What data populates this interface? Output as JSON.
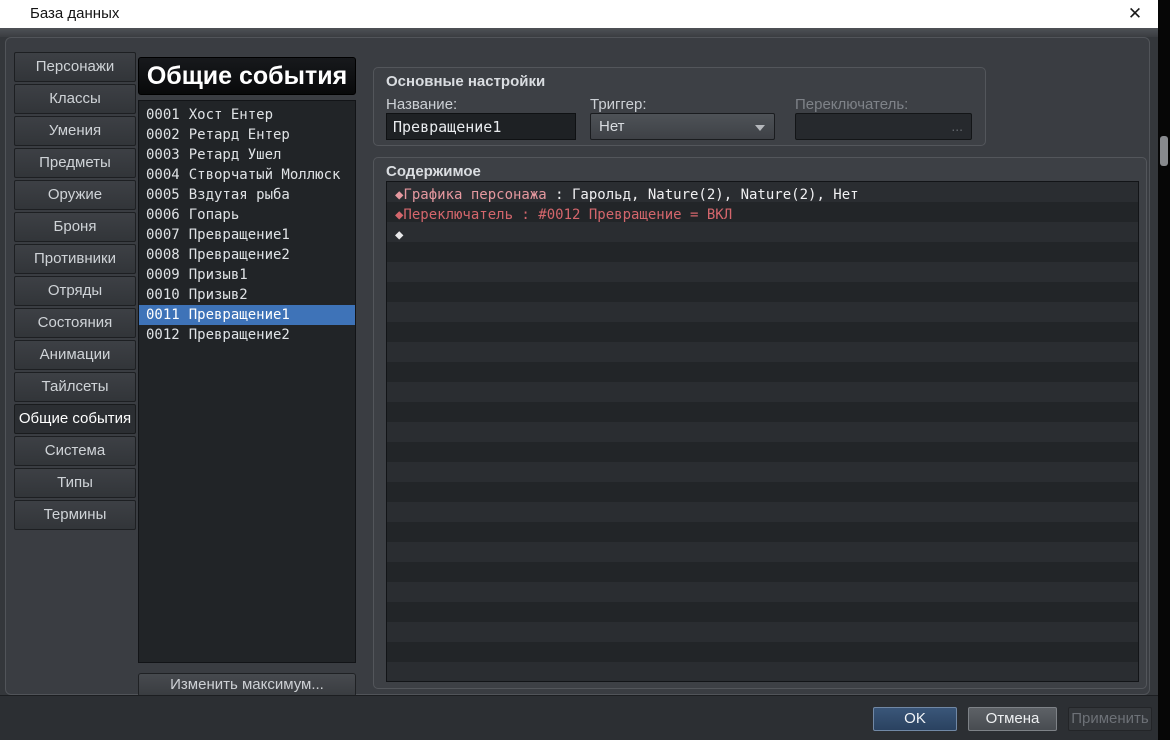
{
  "window": {
    "title": "База данных",
    "close_glyph": "✕"
  },
  "sidebar": {
    "tabs": [
      {
        "label": "Персонажи",
        "active": false
      },
      {
        "label": "Классы",
        "active": false
      },
      {
        "label": "Умения",
        "active": false
      },
      {
        "label": "Предметы",
        "active": false
      },
      {
        "label": "Оружие",
        "active": false
      },
      {
        "label": "Броня",
        "active": false
      },
      {
        "label": "Противники",
        "active": false
      },
      {
        "label": "Отряды",
        "active": false
      },
      {
        "label": "Состояния",
        "active": false
      },
      {
        "label": "Анимации",
        "active": false
      },
      {
        "label": "Тайлсеты",
        "active": false
      },
      {
        "label": "Общие события",
        "active": true
      },
      {
        "label": "Система",
        "active": false
      },
      {
        "label": "Типы",
        "active": false
      },
      {
        "label": "Термины",
        "active": false
      }
    ]
  },
  "list_panel": {
    "header": "Общие события",
    "selected_index": 10,
    "items": [
      {
        "id": "0001",
        "name": "Хост Ентер"
      },
      {
        "id": "0002",
        "name": "Ретард Ентер"
      },
      {
        "id": "0003",
        "name": "Ретард Ушел"
      },
      {
        "id": "0004",
        "name": "Створчатый Моллюск"
      },
      {
        "id": "0005",
        "name": "Вздутая рыба"
      },
      {
        "id": "0006",
        "name": "Гопарь"
      },
      {
        "id": "0007",
        "name": "Превращение1"
      },
      {
        "id": "0008",
        "name": "Превращение2"
      },
      {
        "id": "0009",
        "name": "Призыв1"
      },
      {
        "id": "0010",
        "name": "Призыв2"
      },
      {
        "id": "0011",
        "name": "Превращение1"
      },
      {
        "id": "0012",
        "name": "Превращение2"
      }
    ],
    "change_max_label": "Изменить максимум..."
  },
  "settings": {
    "title": "Основные настройки",
    "name_label": "Название:",
    "name_value": "Превращение1",
    "trigger_label": "Триггер:",
    "trigger_value": "Нет",
    "switch_label": "Переключатель:",
    "switch_value": "",
    "switch_browse_label": "..."
  },
  "contents": {
    "title": "Содержимое",
    "rows": [
      {
        "command": "◆Графика персонажа",
        "params": " : Гарольд, Nature(2), Nature(2), Нет",
        "color": "pink"
      },
      {
        "command": "◆Переключатель : #0012 Превращение = ВКЛ",
        "params": "",
        "color": "red"
      },
      {
        "command": "◆",
        "params": "",
        "color": "white"
      }
    ]
  },
  "footer": {
    "ok_label": "OK",
    "cancel_label": "Отмена",
    "apply_label": "Применить"
  },
  "colors": {
    "selection_blue": "#3e73b8",
    "command_pink": "#e5989f",
    "command_red": "#d4666c",
    "panel_bg": "#3a3d42",
    "list_bg": "#212427",
    "titlebar_bg": "#ffffff"
  }
}
